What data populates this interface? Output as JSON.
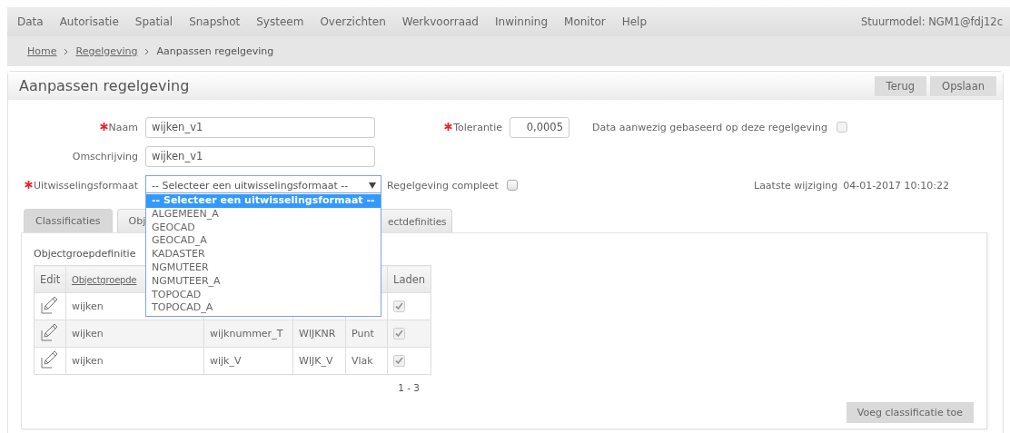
{
  "menu": [
    "Data",
    "Autorisatie",
    "Spatial",
    "Snapshot",
    "Systeem",
    "Overzichten",
    "Werkvoorraad",
    "Inwinning",
    "Monitor",
    "Help"
  ],
  "user": "Stuurmodel: NGM1@fdj12c",
  "breadcrumb": [
    {
      "label": "Home",
      "link": true
    },
    {
      "label": "Regelgeving",
      "link": true
    },
    {
      "label": "Aanpassen regelgeving",
      "link": false
    }
  ],
  "page": {
    "title": "Aanpassen regelgeving",
    "buttons": [
      "Terug",
      "Opslaan"
    ]
  },
  "form": {
    "naam": {
      "label": "Naam",
      "required": true,
      "value": "wijken_v1"
    },
    "tolerantie": {
      "label": "Tolerantie",
      "required": true,
      "value": "0,0005"
    },
    "data_aanwezig": {
      "label": "Data aanwezig gebaseerd op deze regelgeving",
      "checked": false,
      "disabled": true
    },
    "omschrijving": {
      "label": "Omschrijving",
      "required": false,
      "value": "wijken_v1"
    },
    "uitwisselingsformaat": {
      "label": "Uitwisselingsformaat",
      "required": true,
      "value": "-- Selecteer een uitwisselingsformaat --",
      "expanded": true,
      "options": [
        {
          "label": "-- Selecteer een uitwisselingsformaat --",
          "selected": true
        },
        {
          "label": "ALGEMEEN_A",
          "selected": false
        },
        {
          "label": "GEOCAD",
          "selected": false
        },
        {
          "label": "GEOCAD_A",
          "selected": false
        },
        {
          "label": "KADASTER",
          "selected": false
        },
        {
          "label": "NGMUTEER",
          "selected": false
        },
        {
          "label": "NGMUTEER_A",
          "selected": false
        },
        {
          "label": "TOPOCAD",
          "selected": false
        },
        {
          "label": "TOPOCAD_A",
          "selected": false
        }
      ]
    },
    "regelgeving_compleet": {
      "label": "Regelgeving compleet",
      "checked": false,
      "disabled": false
    },
    "laatste_wijziging": {
      "label": "Laatste wijziging",
      "value": "04-01-2017 10:10:22"
    }
  },
  "tabs": [
    {
      "label": "Classificaties",
      "selected": true
    },
    {
      "label": "Obj",
      "selected": false
    },
    {
      "label": "ectdefinities",
      "selected": false
    }
  ],
  "classificaties": {
    "label": "Objectgroepdefinitie",
    "headers": {
      "edit": "Edit",
      "objectgroepde": "Objectgroepde",
      "laden": "Laden"
    },
    "rows": [
      {
        "objectgroep": "wijken",
        "laden": true
      },
      {
        "objectgroep": "wijken",
        "column_3": "wijknummer_T",
        "column_4": "WIJKNR",
        "column_5": "Punt",
        "laden": true
      },
      {
        "objectgroep": "wijken",
        "column_3": "wijk_V",
        "column_4": "WIJK_V",
        "column_5": "Vlak",
        "laden": true
      }
    ],
    "pager": "1 - 3",
    "add_button": "Voeg classificatie toe"
  }
}
